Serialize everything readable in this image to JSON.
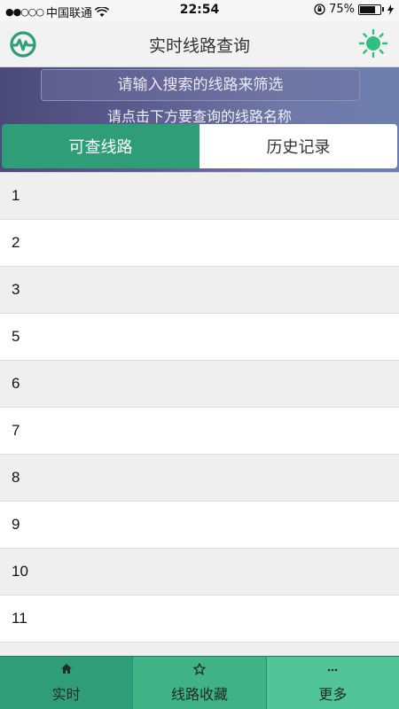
{
  "status_bar": {
    "signal": "●●○○○",
    "carrier": "中国联通",
    "time": "22:54",
    "battery_percent": "75%",
    "battery_level": 0.75
  },
  "header": {
    "title": "实时线路查询",
    "logo_icon": "metro-logo-icon",
    "theme_icon": "sun-icon",
    "accent_color": "#2f9e78"
  },
  "search": {
    "placeholder": "请输入搜索的线路来筛选",
    "hint": "请点击下方要查询的线路名称"
  },
  "tabs": [
    {
      "label": "可查线路",
      "active": true
    },
    {
      "label": "历史记录",
      "active": false
    }
  ],
  "routes": [
    "1",
    "2",
    "3",
    "5",
    "6",
    "7",
    "8",
    "9",
    "10",
    "11"
  ],
  "bottom_nav": [
    {
      "label": "实时",
      "icon": "home-icon"
    },
    {
      "label": "线路收藏",
      "icon": "star-icon"
    },
    {
      "label": "更多",
      "icon": "more-icon"
    }
  ]
}
